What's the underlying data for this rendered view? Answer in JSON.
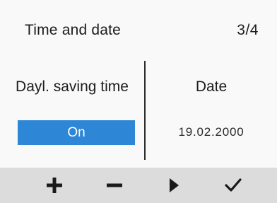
{
  "header": {
    "title": "Time and date",
    "page_indicator": "3/4"
  },
  "left_column": {
    "label": "Dayl. saving time",
    "value": "On"
  },
  "right_column": {
    "label": "Date",
    "value": "19.02.2000"
  },
  "footer": {
    "buttons": [
      {
        "icon": "plus-icon"
      },
      {
        "icon": "minus-icon"
      },
      {
        "icon": "play-icon"
      },
      {
        "icon": "checkmark-icon"
      }
    ]
  },
  "colors": {
    "background": "#f9f9f9",
    "footer_background": "#dcdcdc",
    "selection": "#2e86d6",
    "text": "#1c1c1c"
  }
}
